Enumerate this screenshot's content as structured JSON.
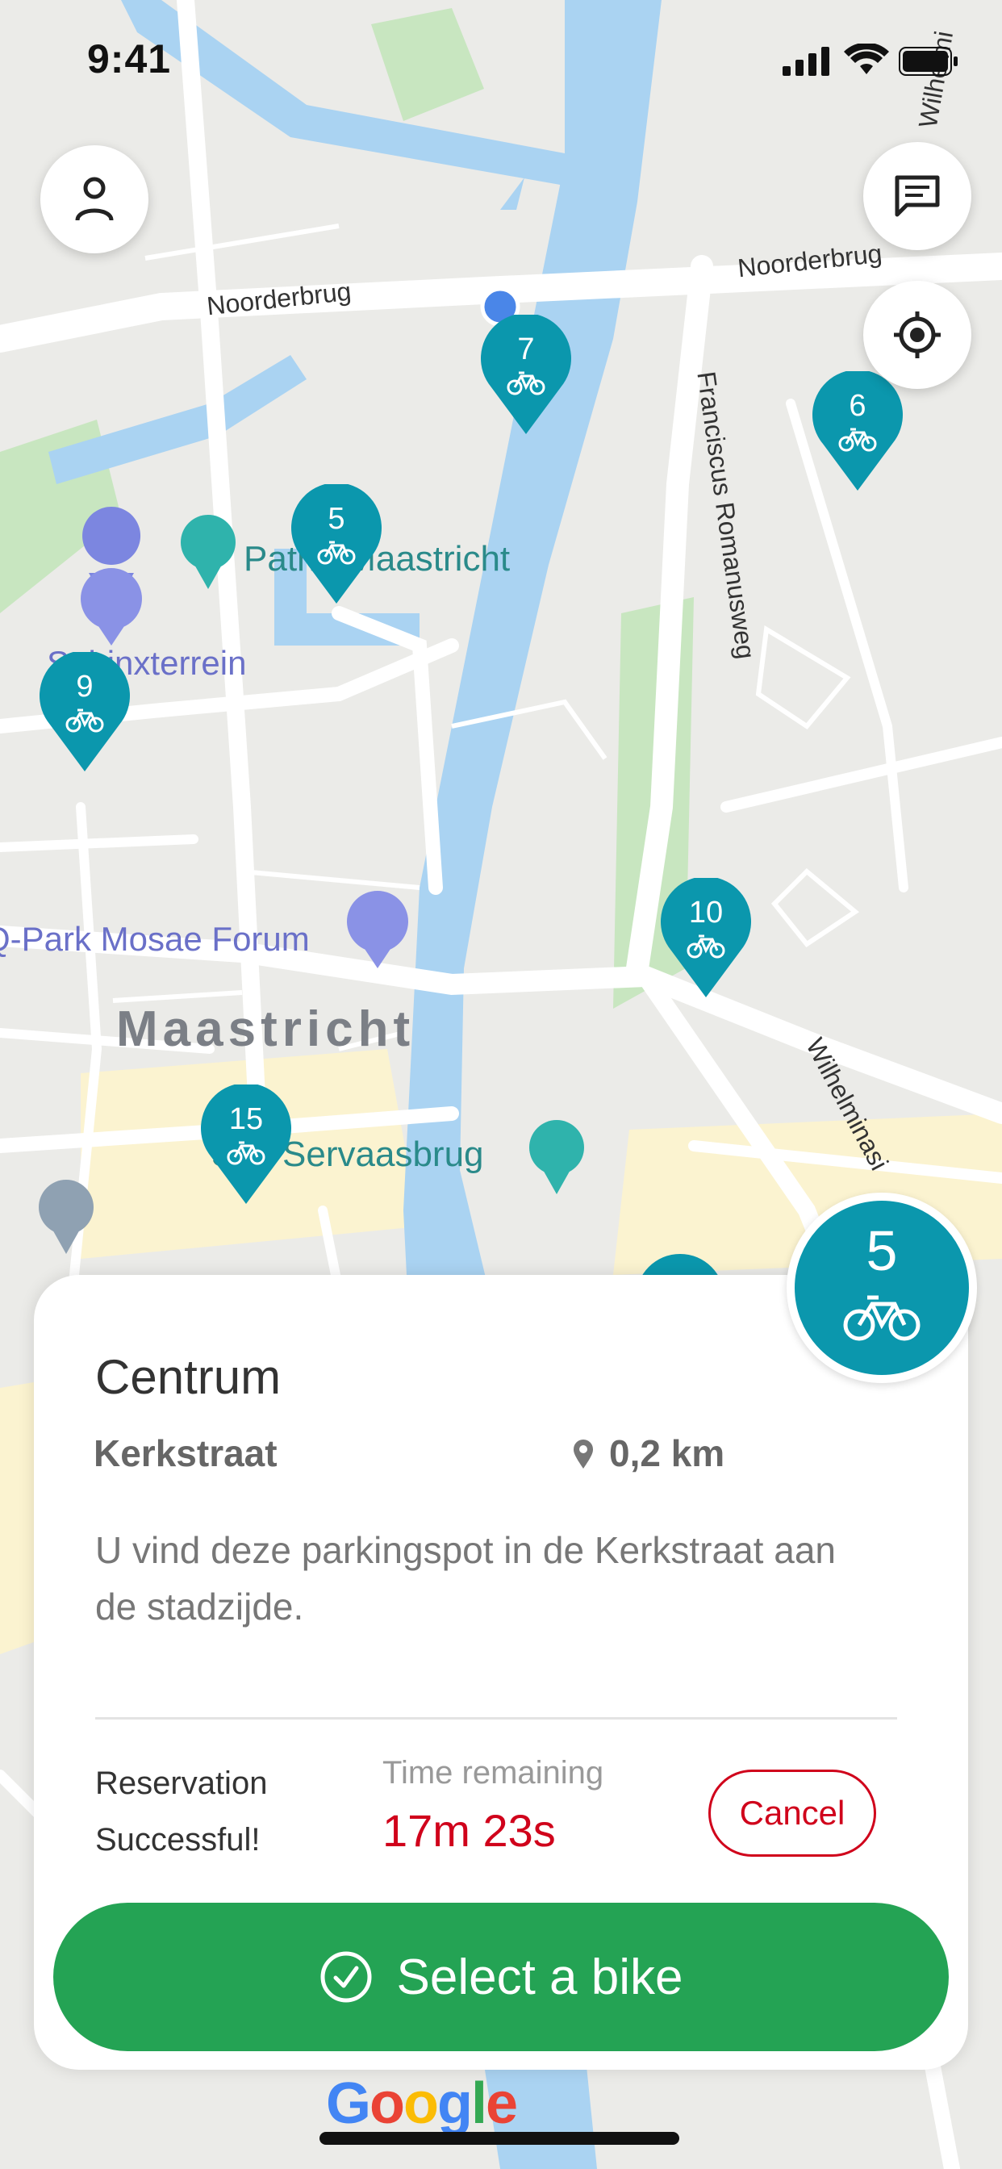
{
  "status_bar": {
    "time": "9:41"
  },
  "map": {
    "road_labels": [
      "Noorderbrug",
      "Noorderbrug",
      "Franciscus Romanusweg",
      "Wilhelminasi",
      "Wilhelmi"
    ],
    "pois": [
      "Pathé Maastricht",
      "Sphinxterrein",
      "Q-Park Mosae Forum",
      "Maastricht",
      "Sint Servaasbrug"
    ],
    "markers": [
      {
        "count": "7"
      },
      {
        "count": "6"
      },
      {
        "count": "5"
      },
      {
        "count": "9"
      },
      {
        "count": "10"
      },
      {
        "count": "15"
      }
    ],
    "colors": {
      "marker": "#0b97ad",
      "water": "#aad3f2",
      "park": "#c8e6c0",
      "accent_green": "#24a354",
      "alert_red": "#d0021b"
    }
  },
  "buttons": {
    "profile_icon": "person-icon",
    "messages_icon": "message-icon",
    "locate_icon": "crosshair-icon"
  },
  "card": {
    "bike_count": "5",
    "title": "Centrum",
    "street": "Kerkstraat",
    "distance": "0,2 km",
    "description": "U vind deze parkingspot in de Kerkstraat aan de stadzijde.",
    "reservation_line1": "Reservation",
    "reservation_line2": "Successful!",
    "time_remaining_label": "Time remaining",
    "time_remaining_value": "17m 23s",
    "cancel_label": "Cancel",
    "select_label": "Select a bike"
  },
  "brand": {
    "google": "Google"
  }
}
